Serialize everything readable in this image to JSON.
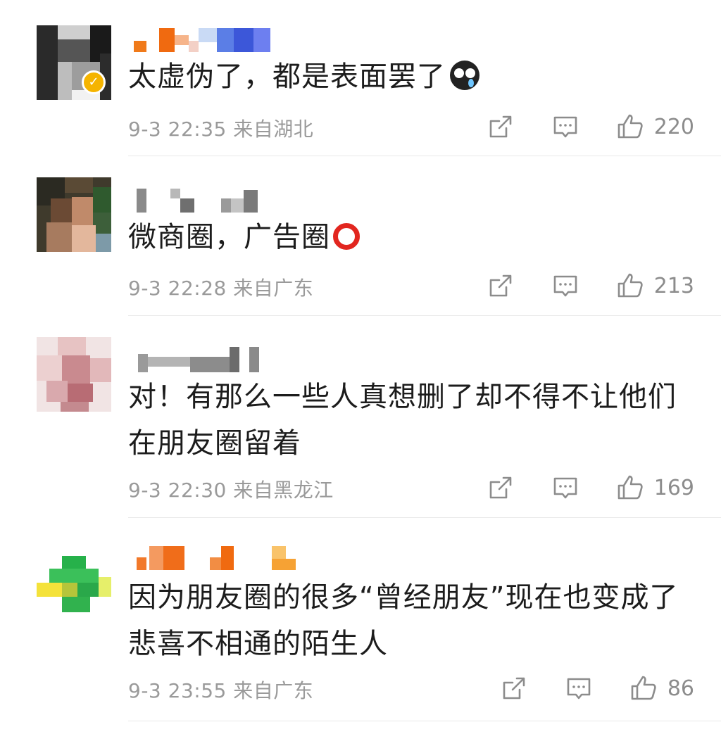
{
  "comments": [
    {
      "text": "太虚伪了，都是表面罢了",
      "emoji": "sob-face",
      "time": "9-3 22:35",
      "location": "来自湖北",
      "likes": "220",
      "verified": true
    },
    {
      "text": "微商圈，广告圈",
      "emoji": "red-circle",
      "time": "9-3 22:28",
      "location": "来自广东",
      "likes": "213",
      "verified": false
    },
    {
      "text": "对！有那么一些人真想删了却不得不让他们在朋友圈留着",
      "time": "9-3 22:30",
      "location": "来自黑龙江",
      "likes": "169",
      "verified": false
    },
    {
      "text": "因为朋友圈的很多“曾经朋友”现在也变成了悲喜不相通的陌生人",
      "time": "9-3 23:55",
      "location": "来自广东",
      "likes": "86",
      "verified": false
    }
  ],
  "icons": {
    "forward": "share-arrow-icon",
    "reply": "comment-bubble-icon",
    "like": "thumbs-up-icon",
    "verified": "verified-badge-icon"
  },
  "colors": {
    "text": "#1c1c1c",
    "meta": "#9a9a9a",
    "icon": "#8c8c8c",
    "divider": "#e9e9e9",
    "verified": "#f5b400"
  }
}
